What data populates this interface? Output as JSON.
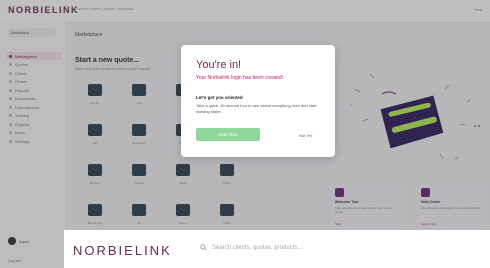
{
  "app": {
    "logo": "NORBIELINK",
    "top_search": "Search clients, quotes, products...",
    "top_right": "Help",
    "breadcrumb": "Marketplace"
  },
  "sidebar": {
    "workspace": "Norbielink",
    "items": [
      {
        "label": "Marketplace",
        "active": true
      },
      {
        "label": "Quotes",
        "active": false
      },
      {
        "label": "Clients",
        "active": false
      },
      {
        "label": "Orders",
        "active": false
      },
      {
        "label": "Reports",
        "active": false
      },
      {
        "label": "Documents",
        "active": false
      },
      {
        "label": "Commissions",
        "active": false
      },
      {
        "label": "Training",
        "active": false
      },
      {
        "label": "Support",
        "active": false
      },
      {
        "label": "News",
        "active": false
      },
      {
        "label": "Settings",
        "active": false
      }
    ],
    "user_name": "Agent",
    "user_menu": "Log out"
  },
  "main": {
    "heading": "Start a new quote...",
    "subheading": "Select one of the products below to start a quote",
    "tiles": [
      {
        "label": "Home"
      },
      {
        "label": "Auto"
      },
      {
        "label": "Life"
      },
      {
        "label": "Health"
      },
      {
        "label": "Pet"
      },
      {
        "label": "Business"
      },
      {
        "label": "Travel"
      },
      {
        "label": "Umbrella"
      },
      {
        "label": "Renters"
      },
      {
        "label": "Condo"
      },
      {
        "label": "Boat"
      },
      {
        "label": "Flood"
      },
      {
        "label": "Motorcycle"
      },
      {
        "label": "RV"
      },
      {
        "label": "Bond"
      },
      {
        "label": "Other"
      }
    ]
  },
  "promo": {
    "sticker": "great today",
    "cards": [
      {
        "title": "Welcome Tour",
        "body": "Take a quick tour to see what's new in your portal",
        "link": "Start"
      },
      {
        "title": "Help Center",
        "body": "Find answers and guides for using Norbielink",
        "link": "Learn more"
      }
    ]
  },
  "modal": {
    "title": "You're in!",
    "subtitle": "Your Norbielink login has been created!",
    "heading": "Let's get you oriented",
    "body": "Take a quick, 60-second tour to see where everything lives and start working faster.",
    "start_button": "Start Tour",
    "later_link": "Not Yet"
  },
  "bottom": {
    "logo": "NORBIELINK",
    "search_placeholder": "Search clients, quotes, products..."
  },
  "colors": {
    "brand": "#6a2a4c",
    "accent_pink": "#c2185b",
    "button_green": "#8fd79a",
    "sticker_purple": "#2e1b5a"
  }
}
